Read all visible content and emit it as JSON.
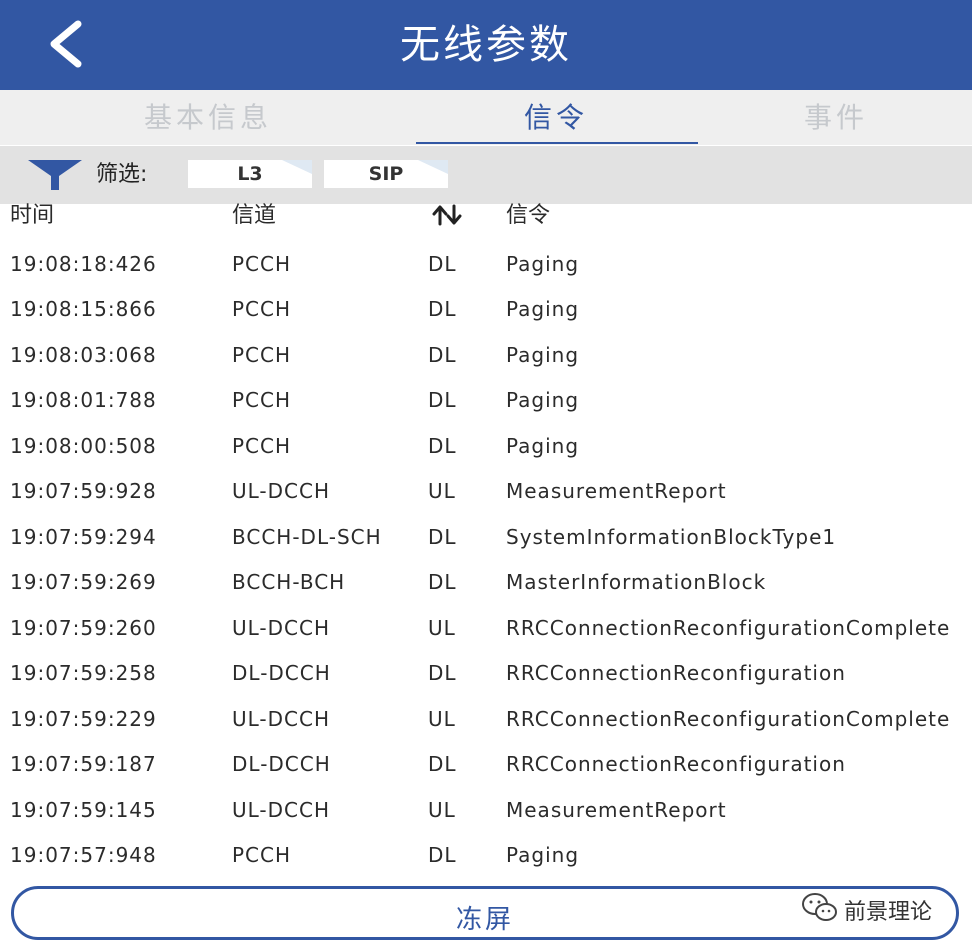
{
  "header": {
    "title": "无线参数"
  },
  "tabs": [
    {
      "label": "基本信息",
      "active": false
    },
    {
      "label": "信令",
      "active": true
    },
    {
      "label": "事件",
      "active": false
    }
  ],
  "filter": {
    "label": "筛选:",
    "chips": [
      "L3",
      "SIP"
    ]
  },
  "table": {
    "headers": {
      "time": "时间",
      "channel": "信道",
      "direction_icon": "up-down-arrows-icon",
      "signal": "信令"
    },
    "rows": [
      {
        "time": "19:08:18:426",
        "channel": "PCCH",
        "dir": "DL",
        "signal": "Paging"
      },
      {
        "time": "19:08:15:866",
        "channel": "PCCH",
        "dir": "DL",
        "signal": "Paging"
      },
      {
        "time": "19:08:03:068",
        "channel": "PCCH",
        "dir": "DL",
        "signal": "Paging"
      },
      {
        "time": "19:08:01:788",
        "channel": "PCCH",
        "dir": "DL",
        "signal": "Paging"
      },
      {
        "time": "19:08:00:508",
        "channel": "PCCH",
        "dir": "DL",
        "signal": "Paging"
      },
      {
        "time": "19:07:59:928",
        "channel": "UL-DCCH",
        "dir": "UL",
        "signal": "MeasurementReport"
      },
      {
        "time": "19:07:59:294",
        "channel": "BCCH-DL-SCH",
        "dir": "DL",
        "signal": "SystemInformationBlockType1"
      },
      {
        "time": "19:07:59:269",
        "channel": "BCCH-BCH",
        "dir": "DL",
        "signal": "MasterInformationBlock"
      },
      {
        "time": "19:07:59:260",
        "channel": "UL-DCCH",
        "dir": "UL",
        "signal": "RRCConnectionReconfigurationComplete"
      },
      {
        "time": "19:07:59:258",
        "channel": "DL-DCCH",
        "dir": "DL",
        "signal": "RRCConnectionReconfiguration"
      },
      {
        "time": "19:07:59:229",
        "channel": "UL-DCCH",
        "dir": "UL",
        "signal": "RRCConnectionReconfigurationComplete"
      },
      {
        "time": "19:07:59:187",
        "channel": "DL-DCCH",
        "dir": "DL",
        "signal": "RRCConnectionReconfiguration"
      },
      {
        "time": "19:07:59:145",
        "channel": "UL-DCCH",
        "dir": "UL",
        "signal": "MeasurementReport"
      },
      {
        "time": "19:07:57:948",
        "channel": "PCCH",
        "dir": "DL",
        "signal": "Paging"
      }
    ]
  },
  "footer": {
    "freeze_label": "冻屏"
  },
  "watermark": {
    "text": "前景理论"
  },
  "colors": {
    "brand": "#3257a3",
    "tab_inactive": "#c6c9cd",
    "filter_bg": "#e2e2e2"
  }
}
